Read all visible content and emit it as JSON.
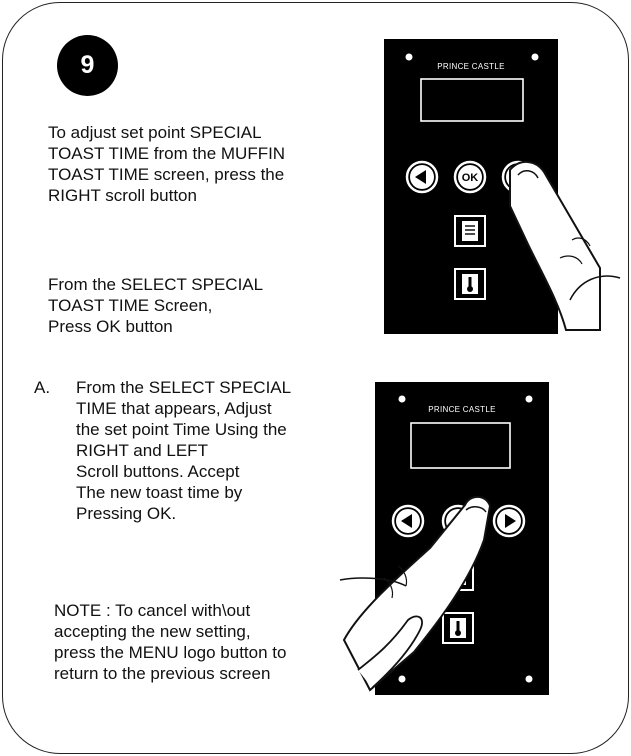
{
  "step": {
    "number": "9"
  },
  "instructions": {
    "p1": "To adjust set point SPECIAL\nTOAST TIME from the MUFFIN\nTOAST TIME screen, press the\nRIGHT scroll button",
    "p2": "From the SELECT SPECIAL\nTOAST TIME Screen,\nPress OK button",
    "p3_marker": "A.",
    "p3": "From the SELECT SPECIAL\nTIME that  appears, Adjust\nthe set point Time Using the\nRIGHT and LEFT\nScroll buttons. Accept\nThe new toast time by\nPressing OK.",
    "p4": "NOTE : To cancel with\\out\naccepting the new setting,\npress the MENU logo button to\nreturn to the previous screen"
  },
  "devices": {
    "top": {
      "brand": "PRINCE CASTLE",
      "ok_label": "OK",
      "pressed_button": "right-scroll"
    },
    "bottom": {
      "brand": "PRINCE CASTLE",
      "pressed_button": "ok"
    }
  },
  "colors": {
    "panel": "#000000",
    "ink": "#111111",
    "border": "#222222"
  },
  "icons": [
    "left-arrow-icon",
    "ok-icon",
    "right-arrow-icon",
    "menu-document-icon",
    "thermometer-icon",
    "pointing-finger-icon"
  ]
}
